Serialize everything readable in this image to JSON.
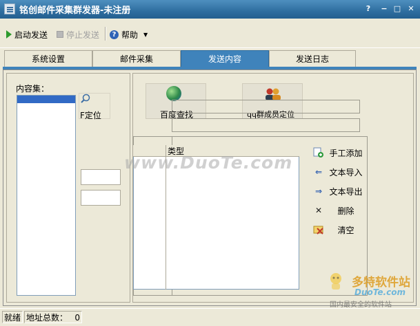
{
  "window": {
    "title": "铭创邮件采集群发器-未注册",
    "controls": [
      "?",
      "−",
      "□",
      "✕"
    ]
  },
  "toolbar": {
    "start_label": "启动发送",
    "stop_label": "停止发送",
    "help_label": "帮助"
  },
  "tabs": [
    {
      "label": "系统设置",
      "active": false
    },
    {
      "label": "邮件采集",
      "active": false
    },
    {
      "label": "发送内容",
      "active": true
    },
    {
      "label": "发送日志",
      "active": false
    }
  ],
  "left_panel": {
    "content_set_label": "内容集：",
    "locate_label": "F定位"
  },
  "right_panel": {
    "baidu_button": "百度查找",
    "qq_button": "qq群成员定位",
    "list_columns": [
      "",
      "类型"
    ],
    "side_buttons": [
      {
        "label": "手工添加",
        "icon": "add-icon"
      },
      {
        "label": "文本导入",
        "icon": "arrow-left-icon"
      },
      {
        "label": "文本导出",
        "icon": "arrow-right-icon"
      },
      {
        "label": "删除",
        "icon": "delete-x-icon"
      },
      {
        "label": "清空",
        "icon": "clear-icon"
      }
    ]
  },
  "watermark": {
    "text": "www.DuoTe.com",
    "logo_title": "多特软件站",
    "logo_site": "DuoTe.com",
    "logo_slogan": "国内最安全的软件站"
  },
  "status_bar": {
    "state": "就绪",
    "count_label": "地址总数：",
    "count_value": "0"
  },
  "colors": {
    "title_bar": "#2f6ea0",
    "active_tab": "#3f83bb",
    "window_bg": "#ece9d8",
    "selection": "#316ac5"
  }
}
